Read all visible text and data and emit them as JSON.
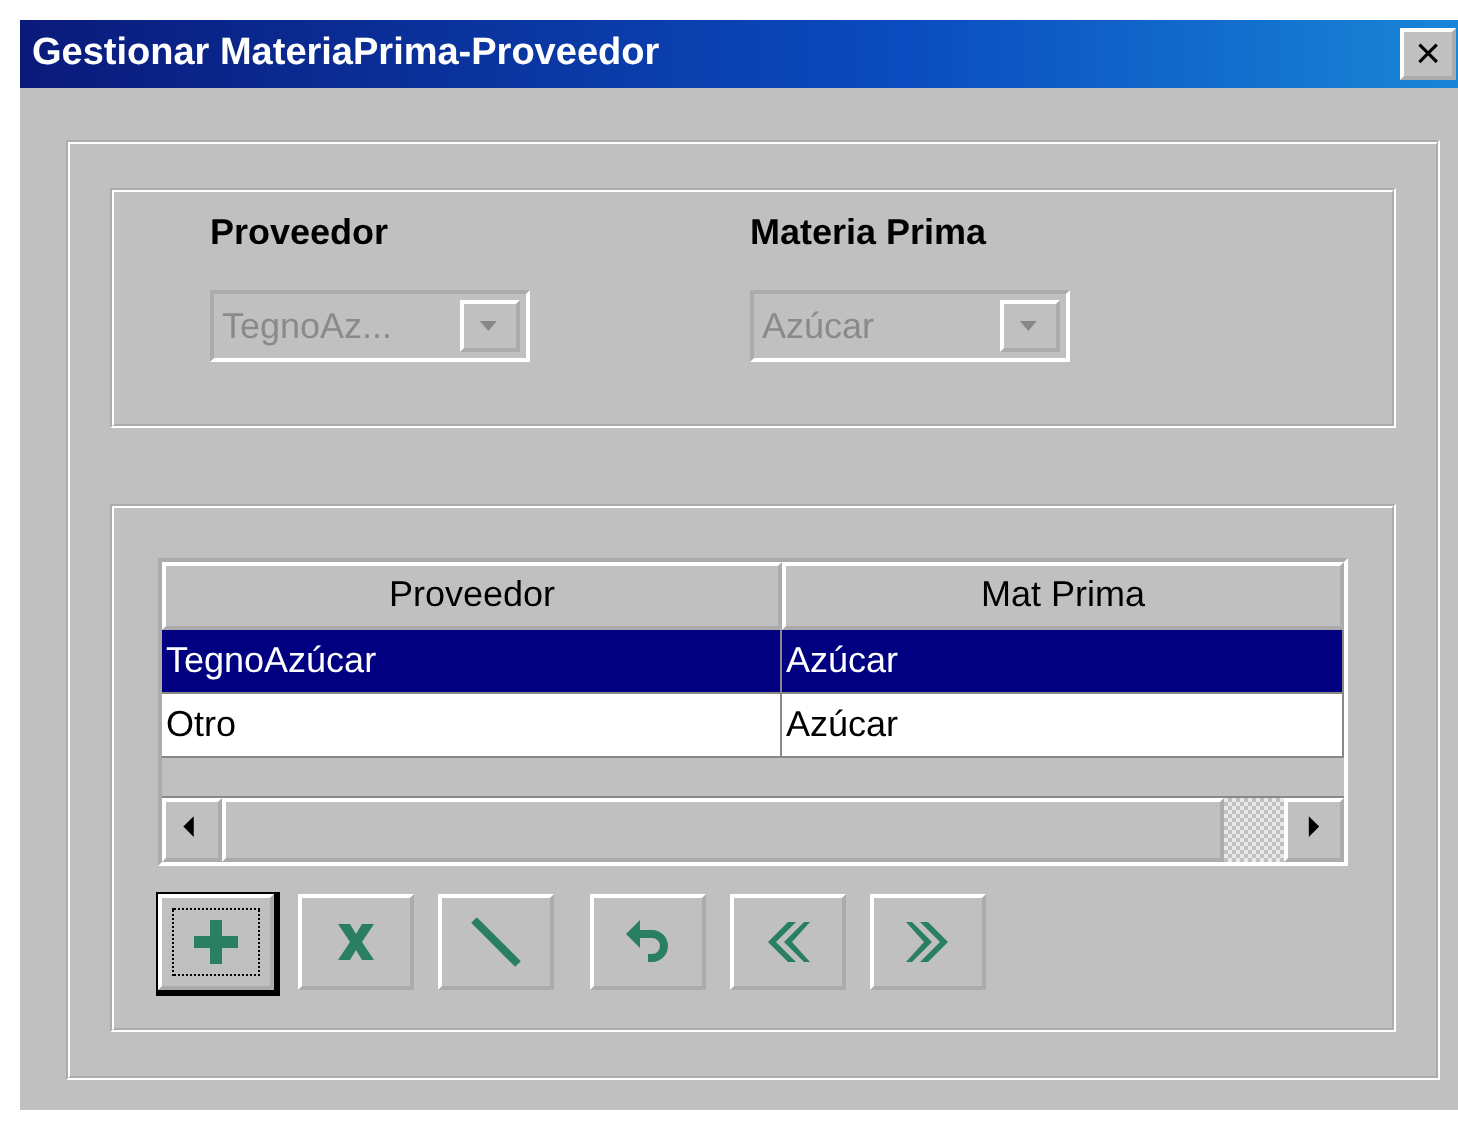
{
  "window": {
    "title": "Gestionar MateriaPrima-Proveedor",
    "close": "×"
  },
  "filters": [
    {
      "label": "Proveedor",
      "value": "TegnoAz...",
      "disabled": true
    },
    {
      "label": "Materia Prima",
      "value": "Azúcar",
      "disabled": true
    }
  ],
  "table": {
    "columns": [
      "Proveedor",
      "Mat Prima"
    ],
    "rows": [
      {
        "cells": [
          "TegnoAzúcar",
          "Azúcar"
        ],
        "selected": true
      },
      {
        "cells": [
          "Otro",
          "Azúcar"
        ],
        "selected": false
      }
    ]
  },
  "toolbar": [
    {
      "kind": "add",
      "focused": true
    },
    {
      "kind": "delete",
      "focused": false
    },
    {
      "kind": "edit",
      "focused": false
    },
    {
      "kind": "undo",
      "focused": false
    },
    {
      "kind": "previous",
      "focused": false
    },
    {
      "kind": "next",
      "focused": false
    }
  ]
}
